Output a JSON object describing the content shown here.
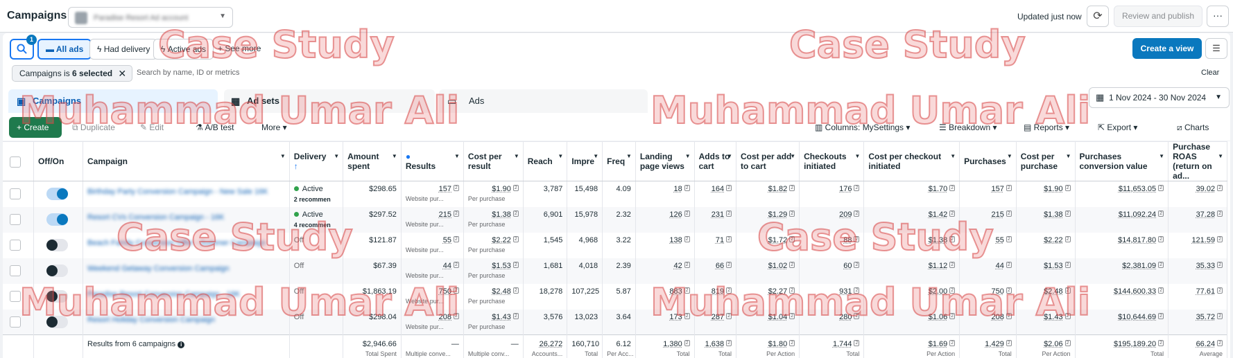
{
  "header": {
    "title": "Campaigns",
    "account_name": "Paradise Resort Ad account",
    "updated": "Updated just now",
    "review_label": "Review and publish",
    "more_label": "···"
  },
  "filters": {
    "search_badge": "1",
    "chips": [
      "All ads",
      "Had delivery",
      "Active ads",
      "See more"
    ],
    "create_view": "Create a view",
    "active_filter_prefix": "Campaigns is ",
    "active_filter_value": "6 selected",
    "search_placeholder": "Search by name, ID or metrics",
    "clear": "Clear",
    "date_range": "1 Nov 2024 - 30 Nov 2024"
  },
  "tabs": [
    "Campaigns",
    "Ad sets",
    "Ads"
  ],
  "toolbar": {
    "create": "Create",
    "duplicate": "Duplicate",
    "edit": "Edit",
    "ab_test": "A/B test",
    "more": "More",
    "columns": "Columns: MySettings",
    "breakdown": "Breakdown",
    "reports": "Reports",
    "export": "Export",
    "charts": "Charts"
  },
  "table": {
    "headers": [
      "Off/On",
      "Campaign",
      "Delivery",
      "Amount spent",
      "Results",
      "Cost per result",
      "Reach",
      "Impre",
      "Freq",
      "Landing page views",
      "Adds to cart",
      "Cost per add to cart",
      "Checkouts initiated",
      "Cost per checkout initiated",
      "Purchases",
      "Cost per purchase",
      "Purchases conversion value",
      "Purchase ROAS (return on ad..."
    ],
    "rows": [
      {
        "on": true,
        "campaign": "Birthday Party Conversion Campaign - New Sale 16K",
        "delivery": "Active",
        "recommend": "2 recommen",
        "spent": "$298.65",
        "results": "157",
        "results_sub": "Website pur...",
        "cpr": "$1.90",
        "cpr_sub": "Per purchase",
        "reach": "3,787",
        "impr": "15,498",
        "freq": "4.09",
        "lpv": "18",
        "atc": "164",
        "cpatc": "$1.82",
        "checkouts": "176",
        "cpco": "$1.70",
        "purchases": "157",
        "cpp": "$1.90",
        "pcv": "$11,653.05",
        "roas": "39.02"
      },
      {
        "on": true,
        "campaign": "Resort CVs Conversion Campaign - 16K",
        "delivery": "Active",
        "recommend": "4 recommen",
        "spent": "$297.52",
        "results": "215",
        "results_sub": "Website pur...",
        "cpr": "$1.38",
        "cpr_sub": "Per purchase",
        "reach": "6,901",
        "impr": "15,978",
        "freq": "2.32",
        "lpv": "126",
        "atc": "231",
        "cpatc": "$1.29",
        "checkouts": "209",
        "cpco": "$1.42",
        "purchases": "215",
        "cpp": "$1.38",
        "pcv": "$11,092.24",
        "roas": "37.28"
      },
      {
        "on": false,
        "campaign": "Beach Family Conversion Offer - Summer Campaign",
        "delivery": "Off",
        "recommend": "",
        "spent": "$121.87",
        "results": "55",
        "results_sub": "Website pur...",
        "cpr": "$2.22",
        "cpr_sub": "Per purchase",
        "reach": "1,545",
        "impr": "4,968",
        "freq": "3.22",
        "lpv": "138",
        "atc": "71",
        "cpatc": "$1.72",
        "checkouts": "88",
        "cpco": "$1.38",
        "purchases": "55",
        "cpp": "$2.22",
        "pcv": "$14,817.80",
        "roas": "121.59"
      },
      {
        "on": false,
        "campaign": "Weekend Getaway Conversion Campaign",
        "delivery": "Off",
        "recommend": "",
        "spent": "$67.39",
        "results": "44",
        "results_sub": "Website pur...",
        "cpr": "$1.53",
        "cpr_sub": "Per purchase",
        "reach": "1,681",
        "impr": "4,018",
        "freq": "2.39",
        "lpv": "42",
        "atc": "66",
        "cpatc": "$1.02",
        "checkouts": "60",
        "cpco": "$1.12",
        "purchases": "44",
        "cpp": "$1.53",
        "pcv": "$2,381.09",
        "roas": "35.33"
      },
      {
        "on": false,
        "campaign": "Paradise Resort Conversion Campaign - 16K",
        "delivery": "Off",
        "recommend": "",
        "spent": "$1,863.19",
        "results": "750",
        "results_sub": "Website pur...",
        "cpr": "$2.48",
        "cpr_sub": "Per purchase",
        "reach": "18,278",
        "impr": "107,225",
        "freq": "5.87",
        "lpv": "883",
        "atc": "819",
        "cpatc": "$2.27",
        "checkouts": "931",
        "cpco": "$2.00",
        "purchases": "750",
        "cpp": "$2.48",
        "pcv": "$144,600.33",
        "roas": "77.61"
      },
      {
        "on": false,
        "campaign": "Resort Holiday Conversion Campaign",
        "delivery": "Off",
        "recommend": "",
        "spent": "$298.04",
        "results": "208",
        "results_sub": "Website pur...",
        "cpr": "$1.43",
        "cpr_sub": "Per purchase",
        "reach": "3,576",
        "impr": "13,023",
        "freq": "3.64",
        "lpv": "173",
        "atc": "287",
        "cpatc": "$1.04",
        "checkouts": "280",
        "cpco": "$1.06",
        "purchases": "208",
        "cpp": "$1.43",
        "pcv": "$10,644.69",
        "roas": "35.72"
      }
    ],
    "totals": {
      "label": "Results from 6 campaigns",
      "spent": "$2,946.66",
      "spent_sub": "Total Spent",
      "results": "—",
      "results_sub": "Multiple conve...",
      "cpr": "—",
      "cpr_sub": "Multiple conv...",
      "reach": "26,272",
      "reach_sub": "Accounts...",
      "impr": "160,710",
      "impr_sub": "Total",
      "freq": "6.12",
      "freq_sub": "Per Acc...",
      "lpv": "1,380",
      "lpv_sub": "Total",
      "atc": "1,638",
      "atc_sub": "Total",
      "cpatc": "$1.80",
      "cpatc_sub": "Per Action",
      "checkouts": "1,744",
      "checkouts_sub": "Total",
      "cpco": "$1.69",
      "cpco_sub": "Per Action",
      "purchases": "1,429",
      "purchases_sub": "Total",
      "cpp": "$2.06",
      "cpp_sub": "Per Action",
      "pcv": "$195,189.20",
      "pcv_sub": "Total",
      "roas": "66.24",
      "roas_sub": "Average"
    }
  },
  "watermark": {
    "line1": "Case Study",
    "line2": "Muhammad Umar Ali"
  }
}
